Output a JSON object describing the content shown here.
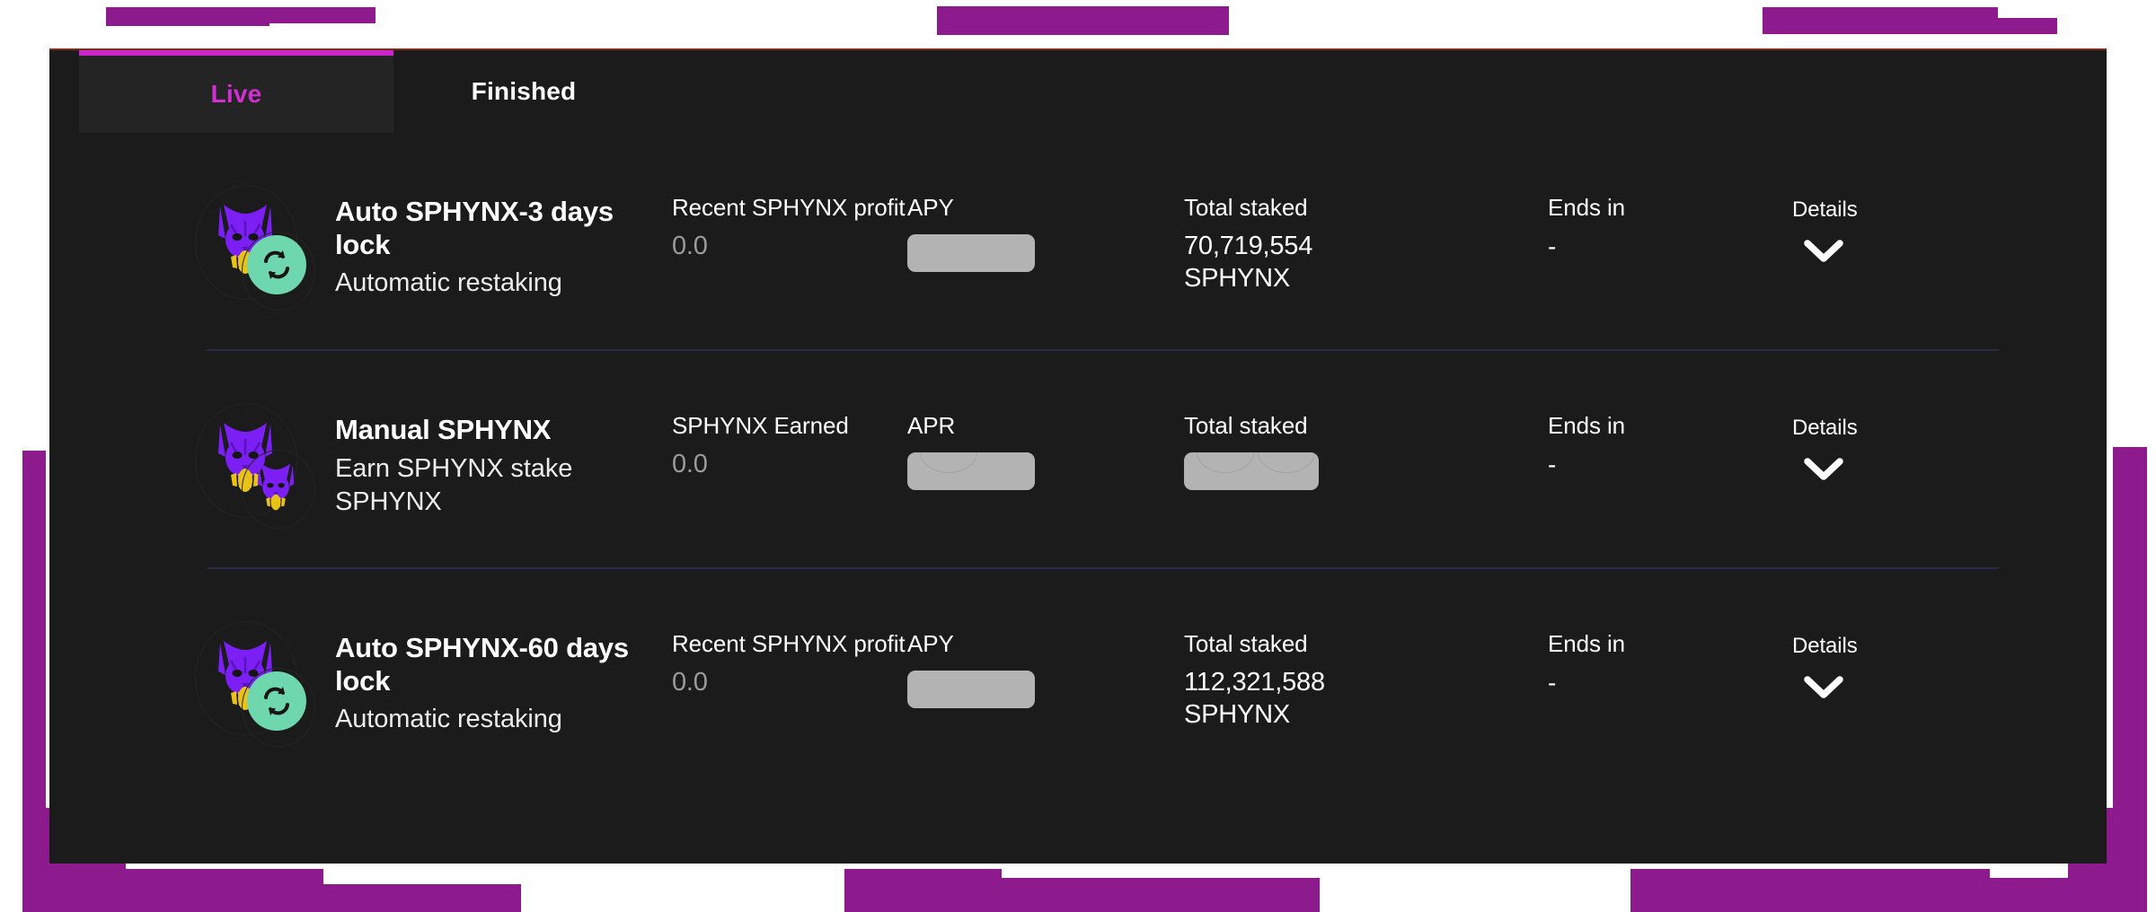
{
  "theme": {
    "accent_magenta": "#cc25cc",
    "deco_purple": "#8e1b8e",
    "card_bg": "#1b1b1b",
    "tab_active_bg": "#242424",
    "divider": "#292a45",
    "skeleton_grey": "#b3b3b3",
    "sphynx_purple": "#7b1ff5",
    "sphynx_gold": "#e8c216",
    "restake_green": "#6fd7ae"
  },
  "tabs": [
    {
      "label": "Live",
      "active": true,
      "name": "tab-live"
    },
    {
      "label": "Finished",
      "active": false,
      "name": "tab-finished"
    }
  ],
  "details": {
    "label": "Details",
    "chevron_icon": "chevron-down-icon"
  },
  "pools": [
    {
      "title": "Auto SPHYNX-3 days lock",
      "subtitle": "Automatic restaking",
      "icon": "sphynx-auto-icon",
      "badge_icon": "restake-icon",
      "profit_label": "Recent SPHYNX profit",
      "profit_value": "0.0",
      "rate_label": "APY",
      "rate_value": "",
      "rate_loading": true,
      "staked_label": "Total staked",
      "staked_value": "70,719,554 SPHYNX",
      "staked_loading": false,
      "ends_label": "Ends in",
      "ends_value": "-"
    },
    {
      "title": "Manual SPHYNX",
      "subtitle": "Earn SPHYNX stake SPHYNX",
      "icon": "sphynx-manual-icon",
      "badge_icon": "sphynx-small-icon",
      "profit_label": "SPHYNX Earned",
      "profit_value": "0.0",
      "rate_label": "APR",
      "rate_value": "",
      "rate_loading": true,
      "staked_label": "Total staked",
      "staked_value": "",
      "staked_loading": true,
      "ends_label": "Ends in",
      "ends_value": "-"
    },
    {
      "title": "Auto SPHYNX-60 days lock",
      "subtitle": "Automatic restaking",
      "icon": "sphynx-auto-icon",
      "badge_icon": "restake-icon",
      "profit_label": "Recent SPHYNX profit",
      "profit_value": "0.0",
      "rate_label": "APY",
      "rate_value": "",
      "rate_loading": true,
      "staked_label": "Total staked",
      "staked_value": "112,321,588 SPHYNX",
      "staked_loading": false,
      "ends_label": "Ends in",
      "ends_value": "-"
    }
  ]
}
